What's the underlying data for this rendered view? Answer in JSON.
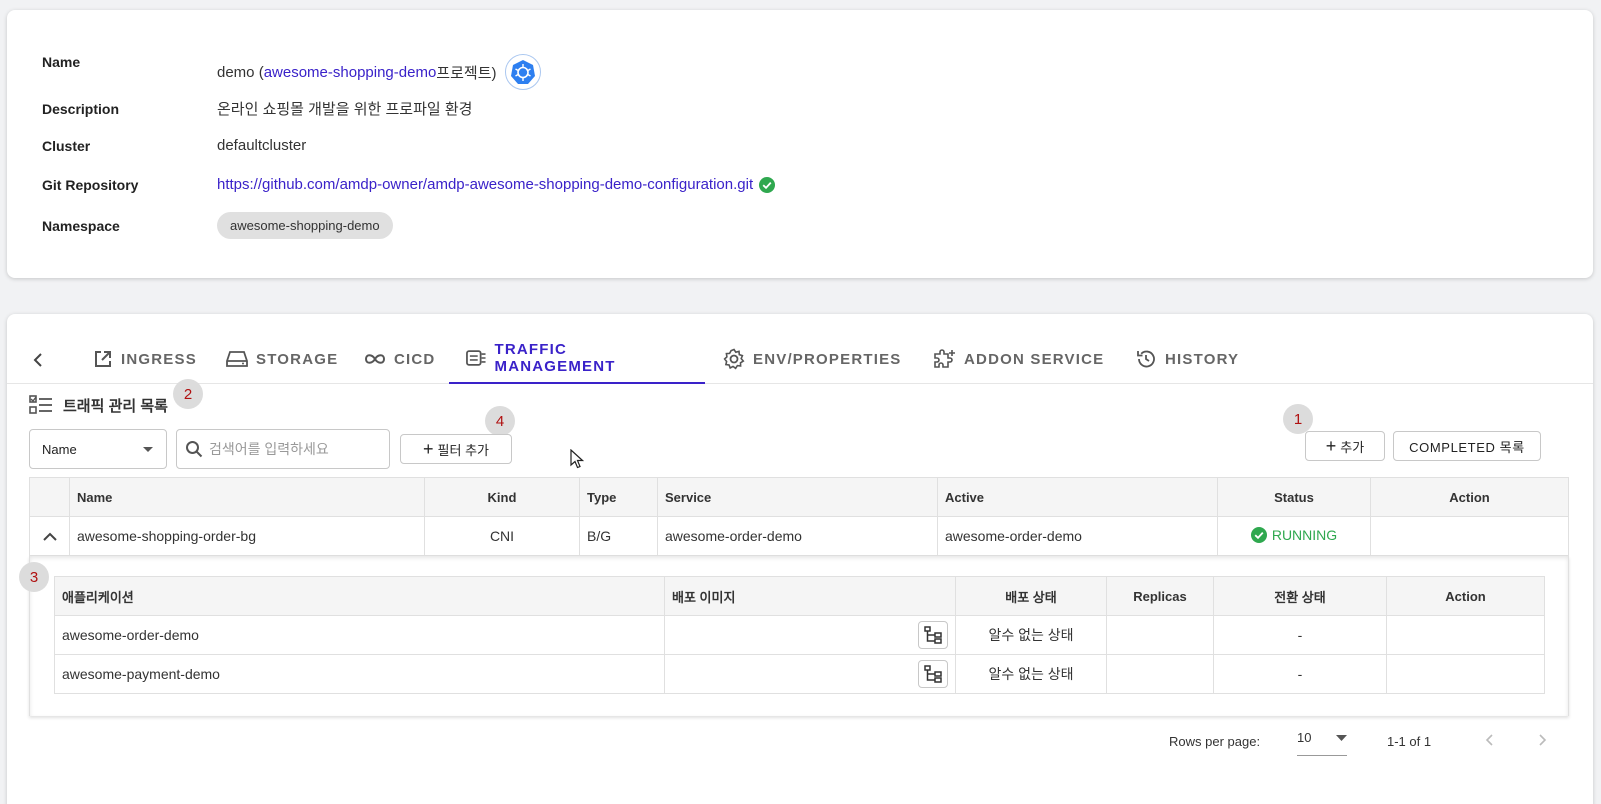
{
  "info": {
    "name_label": "Name",
    "name_prefix": "demo (",
    "project_link": "awesome-shopping-demo",
    "name_suffix": "프로젝트)",
    "description_label": "Description",
    "description_value": "온라인 쇼핑몰 개발을 위한 프로파일 환경",
    "cluster_label": "Cluster",
    "cluster_value": "defaultcluster",
    "git_label": "Git Repository",
    "git_url": "https://github.com/amdp-owner/amdp-awesome-shopping-demo-configuration.git",
    "namespace_label": "Namespace",
    "namespace_value": "awesome-shopping-demo"
  },
  "tabs": [
    {
      "label": "INGRESS",
      "icon": "external-link-icon"
    },
    {
      "label": "STORAGE",
      "icon": "storage-icon"
    },
    {
      "label": "CICD",
      "icon": "infinity-icon"
    },
    {
      "label": "TRAFFIC MANAGEMENT",
      "icon": "traffic-icon",
      "active": true
    },
    {
      "label": "ENV/PROPERTIES",
      "icon": "gear-icon"
    },
    {
      "label": "ADDON SERVICE",
      "icon": "puzzle-icon"
    },
    {
      "label": "HISTORY",
      "icon": "history-icon"
    }
  ],
  "section_title": "트래픽 관리 목록",
  "markers": [
    "1",
    "2",
    "3",
    "4"
  ],
  "filter": {
    "select_value": "Name",
    "search_placeholder": "검색어를 입력하세요",
    "add_filter_label": "필터 추가"
  },
  "actions": {
    "add_label": "추가",
    "completed_label": "COMPLETED 목록"
  },
  "table": {
    "headers": [
      "Name",
      "Kind",
      "Type",
      "Service",
      "Active",
      "Status",
      "Action"
    ],
    "rows": [
      {
        "name": "awesome-shopping-order-bg",
        "kind": "CNI",
        "type": "B/G",
        "service": "awesome-order-demo",
        "active": "awesome-order-demo",
        "status": "RUNNING",
        "action": ""
      }
    ]
  },
  "sub_table": {
    "headers": [
      "애플리케이션",
      "배포 이미지",
      "배포 상태",
      "Replicas",
      "전환 상태",
      "Action"
    ],
    "rows": [
      {
        "app": "awesome-order-demo",
        "image": "",
        "deploy_status": "알수 없는 상태",
        "replicas": "",
        "switch_status": "-",
        "action": ""
      },
      {
        "app": "awesome-payment-demo",
        "image": "",
        "deploy_status": "알수 없는 상태",
        "replicas": "",
        "switch_status": "-",
        "action": ""
      }
    ]
  },
  "pagination": {
    "rows_per_page_label": "Rows per page:",
    "rows_per_page_value": "10",
    "range": "1-1 of 1"
  },
  "colors": {
    "accent": "#3a22c9",
    "running": "#2fa84f",
    "marker_text": "#b01010"
  }
}
